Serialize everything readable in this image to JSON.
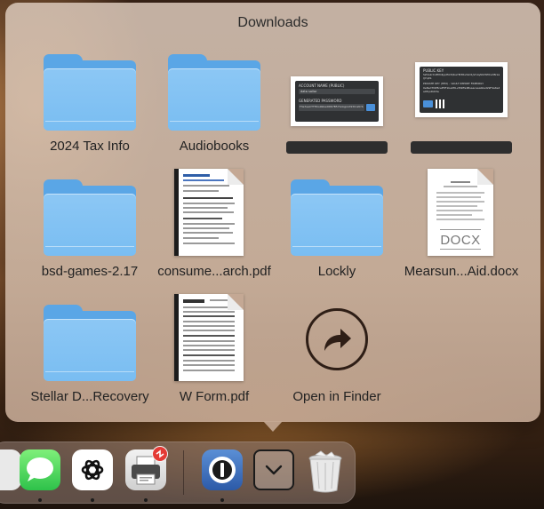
{
  "stack": {
    "title": "Downloads",
    "items": [
      {
        "label": "2024 Tax Info",
        "kind": "folder"
      },
      {
        "label": "Audiobooks",
        "kind": "folder"
      },
      {
        "label": "",
        "kind": "screenshot"
      },
      {
        "label": "",
        "kind": "screenshot"
      },
      {
        "label": "bsd-games-2.17",
        "kind": "folder"
      },
      {
        "label": "consume...arch.pdf",
        "kind": "pdf"
      },
      {
        "label": "Lockly",
        "kind": "folder"
      },
      {
        "label": "Mearsun...Aid.docx",
        "kind": "docx"
      },
      {
        "label": "Stellar D...Recovery",
        "kind": "folder"
      },
      {
        "label": "W Form.pdf",
        "kind": "pdf"
      },
      {
        "label": "Open in Finder",
        "kind": "action"
      }
    ],
    "docx_tag": "DOCX"
  },
  "thumbs": {
    "shot1": {
      "title": "ACCOUNT NAME (PUBLIC)",
      "value": "data sailor",
      "section": "GENERATED PASSWORD",
      "hash": "F3e7eaCTTHCs9kbw0D67B57G4ojp1d93CraN 5d2Y9X0d6Ne4"
    },
    "shot2": {
      "title": "PUBLIC KEY",
      "line1": "SZ2ekrXoBYO4jqdfA3QkaYM3Rs3sO1jVUiqAtbHWCa38rzae3f",
      "line2": "IJ7q4S",
      "section": "PRIVATE KEY (HEX) - VAULT IMPORT FRIENDLY",
      "line3": "0e8ed7t0f8ceE5F1be0f9+f09ffa4Bsaacaaabbsdz9F4a6e4f4",
      "line4": "a9fcp2b63e"
    }
  },
  "dock": {
    "apps": [
      {
        "name": "Messages",
        "icon": "messages-icon",
        "running": true
      },
      {
        "name": "ChatGPT",
        "icon": "chatgpt-icon",
        "running": true
      },
      {
        "name": "Printer",
        "icon": "printer-icon",
        "running": true
      },
      {
        "name": "1Password",
        "icon": "1password-icon",
        "running": true
      },
      {
        "name": "Downloads",
        "icon": "chevron-down-icon",
        "running": false
      },
      {
        "name": "Trash",
        "icon": "trash-icon",
        "running": false
      }
    ]
  },
  "colors": {
    "folder": "#79bdf2",
    "accent_blue": "#4a90d9",
    "badge_red": "#e43a35"
  }
}
